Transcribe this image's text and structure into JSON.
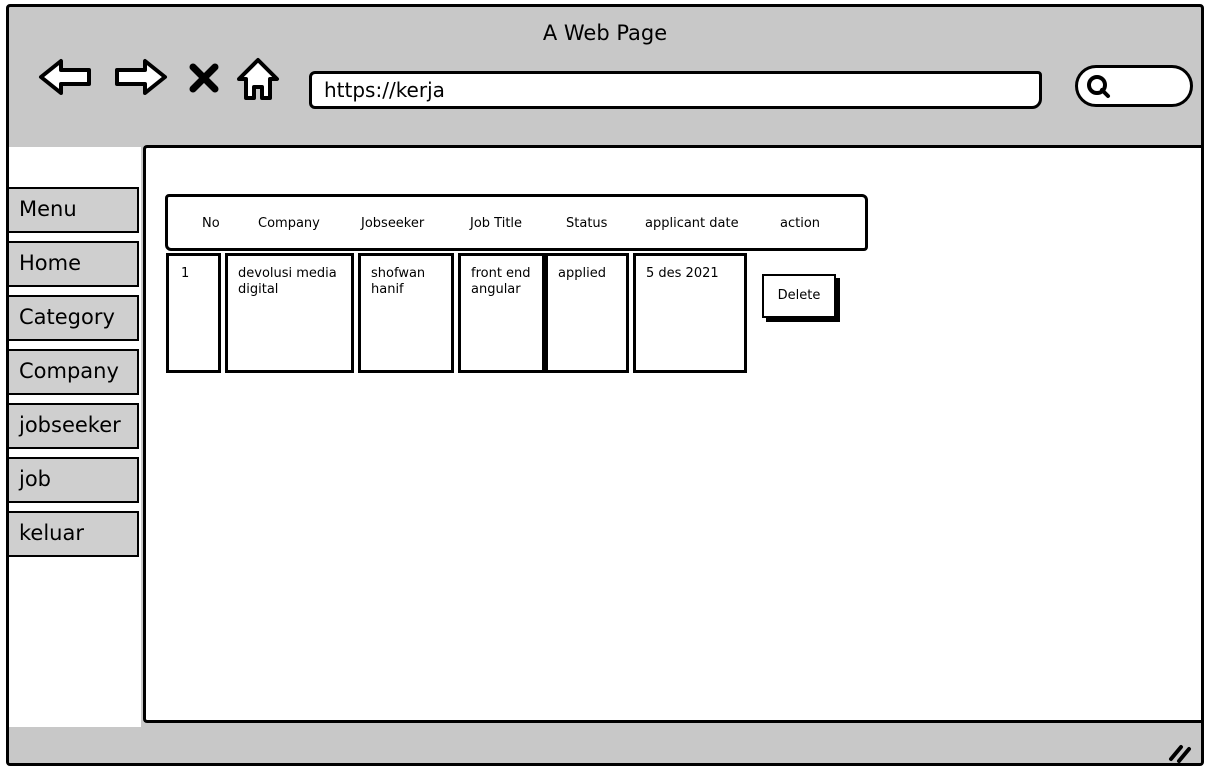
{
  "browser": {
    "window_title": "A Web Page",
    "url": "https://kerja",
    "search_placeholder": ""
  },
  "sidebar": {
    "items": [
      "Menu",
      "Home",
      "Category",
      "Company",
      "jobseeker",
      "job",
      "keluar"
    ]
  },
  "table": {
    "headers": [
      "No",
      "Company",
      "Jobseeker",
      "Job Title",
      "Status",
      "applicant date",
      "action"
    ],
    "rows": [
      {
        "no": "1",
        "company": "devolusi media digital",
        "jobseeker": "shofwan hanif",
        "job_title": "front end angular",
        "status": "applied",
        "applicant_date": "5 des 2021",
        "action": "Delete"
      }
    ]
  }
}
